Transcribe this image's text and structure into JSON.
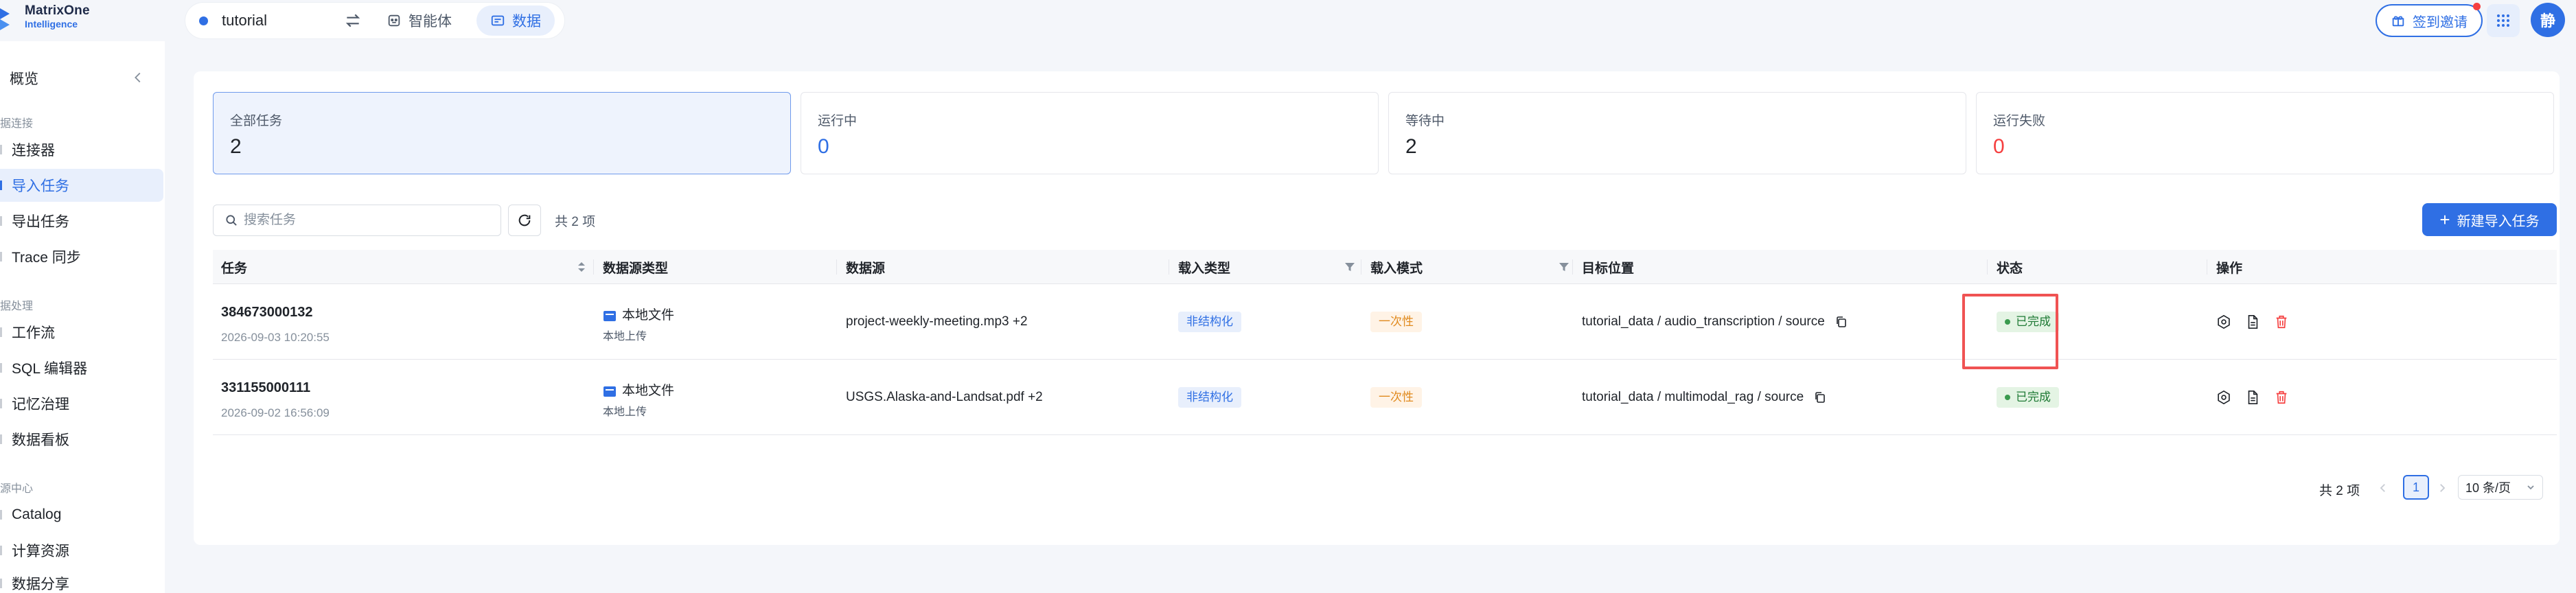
{
  "colors": {
    "accent": "#2f6fe4",
    "danger": "#f53f3f",
    "success": "#3a9a4e",
    "warning": "#e08a1e"
  },
  "brand": {
    "line1": "MatrixOne",
    "line2": "Intelligence"
  },
  "workspace": {
    "name": "tutorial",
    "tabs": [
      {
        "label": "智能体"
      },
      {
        "label": "数据"
      }
    ]
  },
  "header": {
    "signin_label": "签到邀请",
    "avatar_char": "静"
  },
  "sidebar": {
    "overview": "概览",
    "groups": [
      {
        "label": "据连接"
      },
      {
        "label": "据处理"
      },
      {
        "label": "源中心"
      }
    ],
    "items": [
      {
        "label": "连接器"
      },
      {
        "label": "导入任务"
      },
      {
        "label": "导出任务"
      },
      {
        "label": "Trace 同步"
      },
      {
        "label": "工作流"
      },
      {
        "label": "SQL 编辑器"
      },
      {
        "label": "记忆治理"
      },
      {
        "label": "数据看板"
      },
      {
        "label": "Catalog"
      },
      {
        "label": "计算资源"
      },
      {
        "label": "数据分享"
      }
    ]
  },
  "stats": [
    {
      "label": "全部任务",
      "value": "2"
    },
    {
      "label": "运行中",
      "value": "0"
    },
    {
      "label": "等待中",
      "value": "2"
    },
    {
      "label": "运行失败",
      "value": "0"
    }
  ],
  "toolbar": {
    "search_placeholder": "搜索任务",
    "total_text": "共 2 项",
    "new_label": "新建导入任务"
  },
  "table": {
    "columns": [
      "任务",
      "数据源类型",
      "数据源",
      "载入类型",
      "载入模式",
      "目标位置",
      "状态",
      "操作"
    ],
    "rows": [
      {
        "id": "384673000132",
        "time": "2026-09-03 10:20:55",
        "source_type": "本地文件",
        "source_sub": "本地上传",
        "source": "project-weekly-meeting.mp3 +2",
        "load_type": "非结构化",
        "load_mode": "一次性",
        "target": "tutorial_data / audio_transcription / source",
        "status": "已完成"
      },
      {
        "id": "331155000111",
        "time": "2026-09-02 16:56:09",
        "source_type": "本地文件",
        "source_sub": "本地上传",
        "source": "USGS.Alaska-and-Landsat.pdf +2",
        "load_type": "非结构化",
        "load_mode": "一次性",
        "target": "tutorial_data / multimodal_rag / source",
        "status": "已完成"
      }
    ]
  },
  "pagination": {
    "total_text": "共 2 项",
    "current": "1",
    "page_size": "10 条/页"
  }
}
